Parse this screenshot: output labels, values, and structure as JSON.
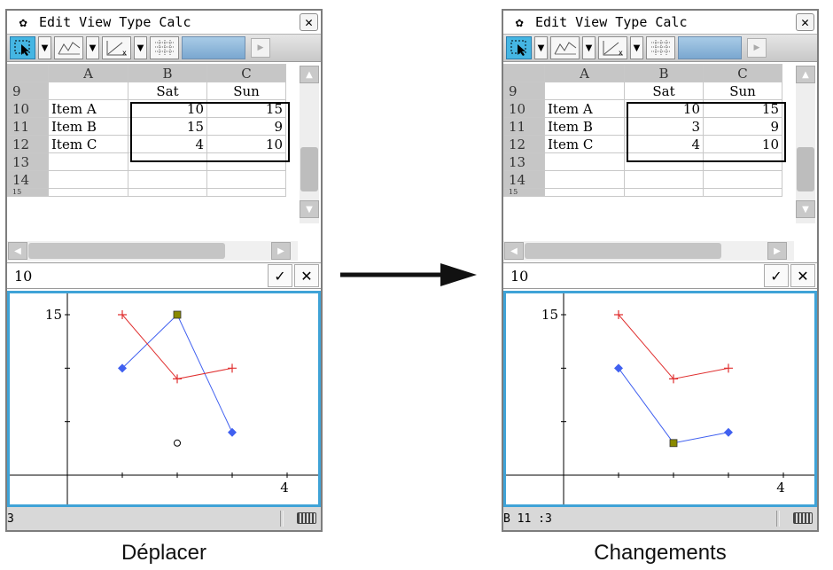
{
  "menu": {
    "gear_label": "✿",
    "items": [
      "Edit",
      "View",
      "Type",
      "Calc"
    ],
    "close_label": "✕"
  },
  "edit_line": {
    "value": "10",
    "ok_label": "✓",
    "cancel_label": "✕"
  },
  "spreadsheet": {
    "columns": [
      "A",
      "B",
      "C"
    ],
    "rows": [
      {
        "num": "9",
        "a": "",
        "b": "Sat",
        "c": "Sun"
      },
      {
        "num": "10",
        "a": "Item  A",
        "b": "10",
        "c": "15"
      },
      {
        "num": "11",
        "a": "Item  B",
        "b": "15",
        "c": "9"
      },
      {
        "num": "12",
        "a": "Item  C",
        "b": "4",
        "c": "10"
      },
      {
        "num": "13",
        "a": "",
        "b": "",
        "c": ""
      },
      {
        "num": "14",
        "a": "",
        "b": "",
        "c": ""
      },
      {
        "num": "15",
        "a": "",
        "b": "",
        "c": ""
      }
    ]
  },
  "panel_right": {
    "b11": "3",
    "status": "B 11 :3"
  },
  "panel_left": {
    "status": "3"
  },
  "captions": {
    "left": "Déplacer",
    "right": "Changements"
  },
  "graph": {
    "y_tick_label": "15",
    "x_tick_label": "4"
  },
  "colors": {
    "series_sat": "#4060f0",
    "series_sun": "#e03030",
    "graph_border": "#3fa3d7",
    "selection": "#45b6e3"
  },
  "chart_data": [
    {
      "type": "line",
      "x": [
        1,
        2,
        3
      ],
      "series": [
        {
          "name": "Sat",
          "values": [
            10,
            15,
            4
          ]
        },
        {
          "name": "Sun",
          "values": [
            15,
            9,
            10
          ]
        }
      ],
      "dragged_point_target": {
        "x": 2,
        "y": 3
      },
      "x_tick_labels": [
        "4"
      ],
      "y_tick_labels": [
        "15"
      ],
      "xlim": [
        0,
        4
      ],
      "ylim": [
        0,
        15
      ]
    },
    {
      "type": "line",
      "x": [
        1,
        2,
        3
      ],
      "series": [
        {
          "name": "Sat",
          "values": [
            10,
            3,
            4
          ]
        },
        {
          "name": "Sun",
          "values": [
            15,
            9,
            10
          ]
        }
      ],
      "x_tick_labels": [
        "4"
      ],
      "y_tick_labels": [
        "15"
      ],
      "xlim": [
        0,
        4
      ],
      "ylim": [
        0,
        15
      ]
    }
  ]
}
